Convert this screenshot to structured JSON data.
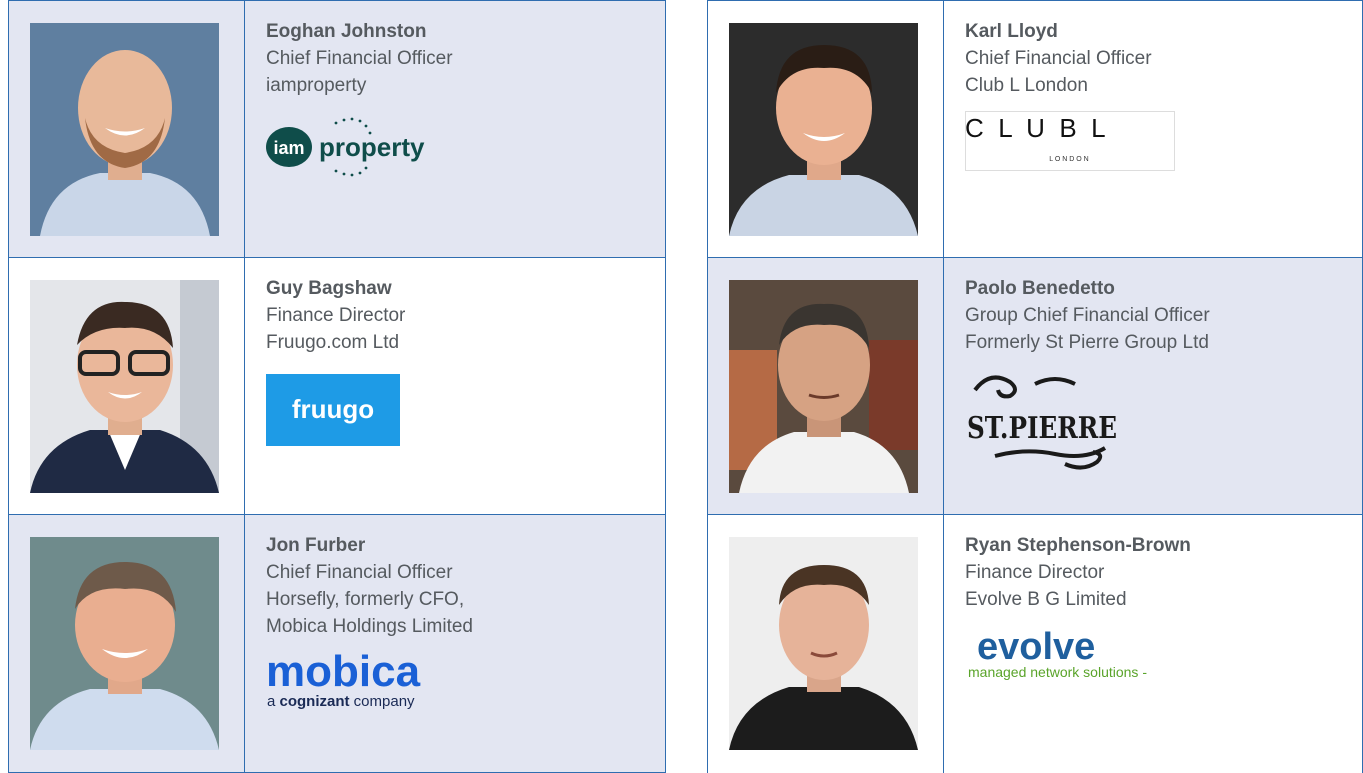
{
  "people": [
    {
      "name": "Eoghan Johnston",
      "role": "Chief Financial Officer",
      "lines": [
        "iamproperty"
      ],
      "logo": {
        "type": "iamproperty",
        "text_a": "iam",
        "text_b": "property",
        "color": "#0f4d4a"
      }
    },
    {
      "name": "Guy Bagshaw",
      "role": "Finance Director",
      "lines": [
        "Fruugo.com Ltd"
      ],
      "logo": {
        "type": "fruugo",
        "text": "fruugo",
        "color": "#1e9be6"
      }
    },
    {
      "name": "Jon Furber",
      "role": "Chief Financial Officer",
      "lines": [
        "Horsefly, formerly CFO,",
        "Mobica Holdings Limited"
      ],
      "logo": {
        "type": "mobica",
        "text": "mobica",
        "sub_a": "a ",
        "sub_b": "cognizant",
        "sub_c": " company",
        "color": "#1a60d6"
      }
    },
    {
      "name": "Karl Lloyd",
      "role": "Chief Financial Officer",
      "lines": [
        "Club L London"
      ],
      "logo": {
        "type": "clubl",
        "text": "C  L  U  B  L",
        "sub": "L O N D O N"
      }
    },
    {
      "name": "Paolo Benedetto",
      "role": "Group Chief Financial Officer",
      "lines": [
        "Formerly St Pierre Group Ltd"
      ],
      "logo": {
        "type": "stpierre",
        "text": "ST.PIERRE"
      }
    },
    {
      "name": "Ryan Stephenson-Brown",
      "role": "Finance Director",
      "lines": [
        "Evolve B G Limited"
      ],
      "logo": {
        "type": "evolve",
        "text": "evolve",
        "sub": "managed network solutions -",
        "color": "#1f5f9e",
        "sub_color": "#5aa42a"
      }
    }
  ]
}
